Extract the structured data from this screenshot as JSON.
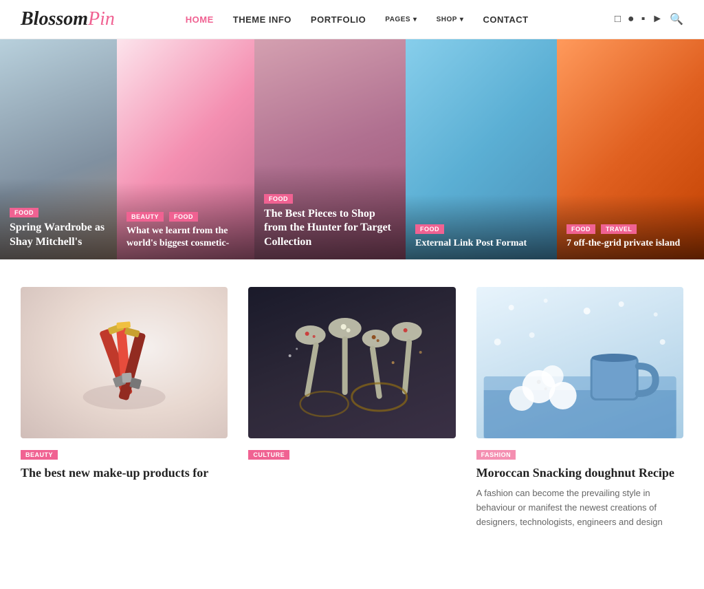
{
  "logo": {
    "part1": "Blossom",
    "part2": "Pin"
  },
  "nav": {
    "items": [
      {
        "label": "HOME",
        "active": true,
        "dropdown": false
      },
      {
        "label": "THEME INFO",
        "active": false,
        "dropdown": false
      },
      {
        "label": "PORTFOLIO",
        "active": false,
        "dropdown": false
      },
      {
        "label": "PAGES",
        "active": false,
        "dropdown": true
      },
      {
        "label": "SHOP",
        "active": false,
        "dropdown": true
      },
      {
        "label": "CONTACT",
        "active": false,
        "dropdown": false
      }
    ],
    "social": [
      "facebook",
      "instagram",
      "pinterest",
      "linkedin",
      "youtube"
    ]
  },
  "hero": {
    "cards": [
      {
        "tags": [
          "FOOD"
        ],
        "title": "Spring Wardrobe as Shay Mitchell's",
        "partial": true
      },
      {
        "tags": [
          "BEAUTY",
          "FOOD"
        ],
        "title": "What we learnt from the world's biggest cosmetic-"
      },
      {
        "tags": [
          "FOOD"
        ],
        "title": "The Best Pieces to Shop from the Hunter for Target Collection"
      },
      {
        "tags": [
          "FOOD"
        ],
        "title": "External Link Post Format"
      },
      {
        "tags": [
          "FOOD",
          "TRAVEL"
        ],
        "title": "7 off-the-grid private island"
      }
    ]
  },
  "posts": [
    {
      "tag": "BEAUTY",
      "title": "The best new make-up products for",
      "excerpt": "",
      "thumb_type": "beauty"
    },
    {
      "tag": "CULTURE",
      "title": "",
      "excerpt": "",
      "thumb_type": "spices"
    },
    {
      "tag": "FASHION",
      "title": "Moroccan Snacking doughnut Recipe",
      "excerpt": "A fashion can become the prevailing style in behaviour or manifest the newest creations of designers, technologists, engineers and design",
      "thumb_type": "winter"
    }
  ]
}
